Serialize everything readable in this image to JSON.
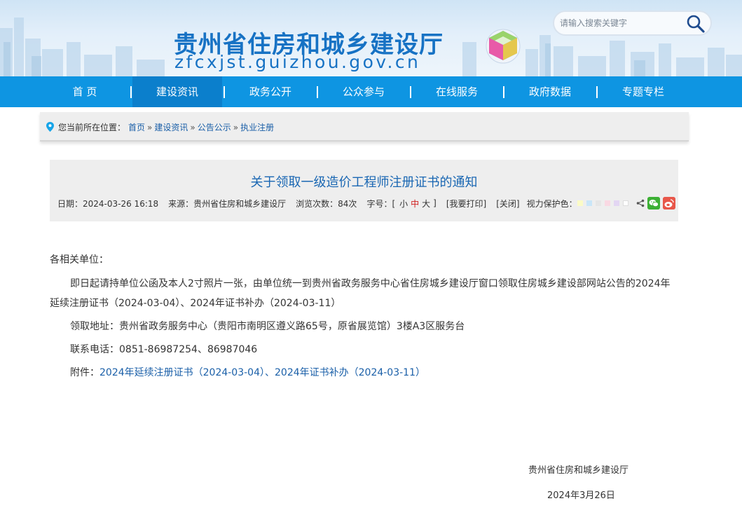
{
  "header": {
    "site_title": "贵州省住房和城乡建设厅",
    "site_domain": "zfcxjst.guizhou.gov.cn",
    "search_placeholder": "请输入搜索关键字"
  },
  "nav": {
    "items": [
      {
        "label": "首 页"
      },
      {
        "label": "建设资讯",
        "active": true
      },
      {
        "label": "政务公开"
      },
      {
        "label": "公众参与"
      },
      {
        "label": "在线服务"
      },
      {
        "label": "政府数据"
      },
      {
        "label": "专题专栏"
      }
    ]
  },
  "breadcrumb": {
    "label": "您当前所在位置：",
    "items": [
      "首页",
      "建设资讯",
      "公告公示",
      "执业注册"
    ],
    "sep": "»"
  },
  "article": {
    "title": "关于领取一级造价工程师注册证书的通知",
    "meta": {
      "date": "日期：2024-03-26 16:18",
      "source": "来源：贵州省住房和城乡建设厅",
      "views": "浏览次数：84次",
      "font_label": "字号：[",
      "font_small": "小",
      "font_medium": "中",
      "font_large": "大",
      "font_close": "]",
      "print": "[我要打印]",
      "close": "[关闭]",
      "eye_color": "视力保护色："
    },
    "eye_colors": [
      "#fbfbc6",
      "#c9e6f8",
      "#e6e6e6",
      "#f9d9e3",
      "#e3d6f3",
      "#f3f3f3"
    ],
    "greeting": "各相关单位：",
    "para1_line1": "即日起请持单位公函及本人2寸照片一张，由单位统一到贵州省政务服务中心省住房城乡建设厅窗口领取住房城乡建设部网站公告的2024年",
    "para1_line2": "延续注册证书（2024-03-04）、2024年证书补办（2024-03-11）",
    "address": "领取地址：贵州省政务服务中心（贵阳市南明区遵义路65号，原省展览馆）3楼A3区服务台",
    "phone": "联系电话：0851-86987254、86987046",
    "attach_label": "附件：",
    "attach_link1": "2024年延续注册证书（2024-03-04）",
    "attach_sep": "、",
    "attach_link2": "2024年证书补办（2024-03-11）",
    "sign_org": "贵州省住房和城乡建设厅",
    "sign_date": "2024年3月26日"
  },
  "colors": {
    "nav_bg": "#0e95e2",
    "nav_active": "#0b7fcc",
    "title_blue": "#1772c4",
    "link_blue": "#1a5fa8"
  }
}
